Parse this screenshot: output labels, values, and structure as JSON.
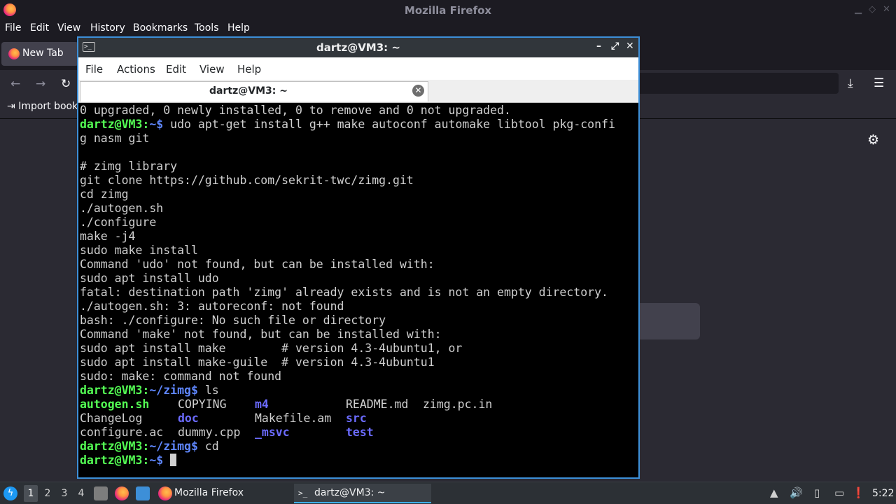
{
  "firefox": {
    "window_title": "Mozilla Firefox",
    "menu": [
      "File",
      "Edit",
      "View",
      "History",
      "Bookmarks",
      "Tools",
      "Help"
    ],
    "tab_label": "New Tab",
    "import_bookmarks": "Import book"
  },
  "terminal": {
    "window_title": "dartz@VM3: ~",
    "menu": [
      "File",
      "Actions",
      "Edit",
      "View",
      "Help"
    ],
    "tab_label": "dartz@VM3: ~",
    "output": [
      "0 upgraded, 0 newly installed, 0 to remove and 0 not upgraded.",
      {
        "user": "dartz@VM3",
        "sep": ":",
        "path": "~",
        "sym": "$ ",
        "cmd": "udo apt-get install g++ make autoconf automake libtool pkg-confi"
      },
      "g nasm git",
      "",
      "# zimg library",
      "git clone https://github.com/sekrit-twc/zimg.git",
      "cd zimg",
      "./autogen.sh",
      "./configure",
      "make -j4",
      "sudo make install",
      "Command 'udo' not found, but can be installed with:",
      "sudo apt install udo",
      "fatal: destination path 'zimg' already exists and is not an empty directory.",
      "./autogen.sh: 3: autoreconf: not found",
      "bash: ./configure: No such file or directory",
      "Command 'make' not found, but can be installed with:",
      "sudo apt install make        # version 4.3-4ubuntu1, or",
      "sudo apt install make-guile  # version 4.3-4ubuntu1",
      "sudo: make: command not found",
      {
        "user": "dartz@VM3",
        "sep": ":",
        "path": "~/zimg",
        "sym": "$ ",
        "cmd": "ls"
      },
      {
        "ls": [
          [
            "autogen.sh",
            "exec"
          ],
          [
            "COPYING",
            ""
          ],
          [
            "m4",
            "dir"
          ],
          [
            "README.md",
            ""
          ],
          [
            "zimg.pc.in",
            ""
          ]
        ]
      },
      {
        "ls": [
          [
            "ChangeLog",
            ""
          ],
          [
            "doc",
            "dir"
          ],
          [
            "Makefile.am",
            ""
          ],
          [
            "src",
            "dir"
          ]
        ]
      },
      {
        "ls": [
          [
            "configure.ac",
            ""
          ],
          [
            "dummy.cpp",
            ""
          ],
          [
            "_msvc",
            "dir"
          ],
          [
            "test",
            "dir"
          ]
        ]
      },
      {
        "user": "dartz@VM3",
        "sep": ":",
        "path": "~/zimg",
        "sym": "$ ",
        "cmd": "cd"
      },
      {
        "user": "dartz@VM3",
        "sep": ":",
        "path": "~",
        "sym": "$ ",
        "cmd": "",
        "cursor": true
      }
    ]
  },
  "taskbar": {
    "workspaces": [
      "1",
      "2",
      "3",
      "4"
    ],
    "tasks": [
      "Mozilla Firefox",
      "dartz@VM3: ~"
    ],
    "clock": "5:22"
  }
}
